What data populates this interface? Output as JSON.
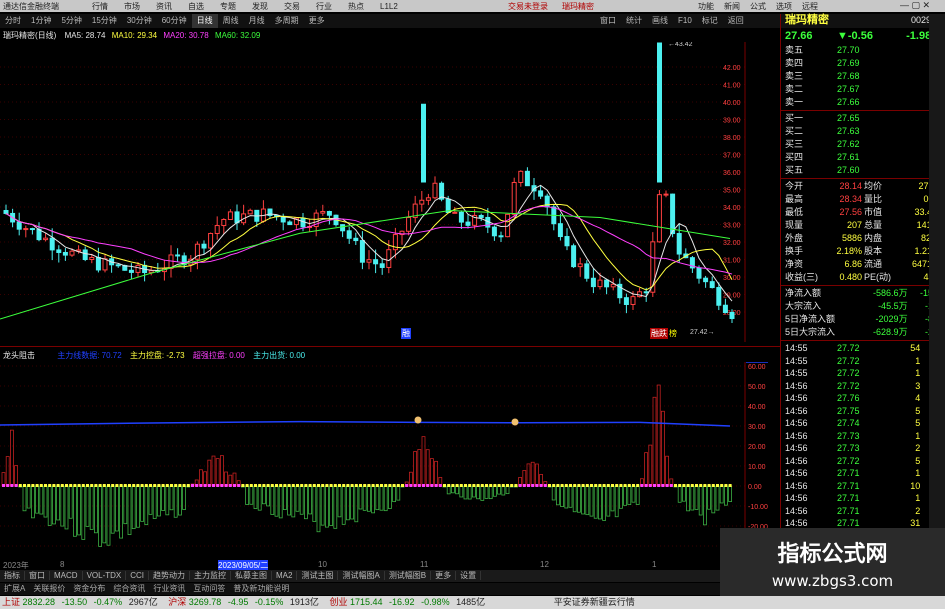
{
  "titlebar": {
    "app_title": "通达信金融终端",
    "menus": [
      "行情",
      "市场",
      "资讯",
      "自选",
      "专题",
      "发现",
      "交易",
      "行业",
      "热点",
      "L1L2"
    ],
    "center_links": [
      "交易未登录",
      "瑞玛精密"
    ],
    "right_links": [
      "功能",
      "新闻",
      "公式",
      "选项",
      "远程"
    ]
  },
  "periodbar": {
    "periods": [
      "分时",
      "1分钟",
      "5分钟",
      "15分钟",
      "30分钟",
      "60分钟",
      "日线",
      "周线",
      "月线",
      "多周期",
      "更多"
    ],
    "active": "日线",
    "right_tools": [
      "窗口",
      "统计",
      "画线",
      "F10",
      "标记",
      "返回"
    ]
  },
  "chart": {
    "stock_label": "瑞玛精密(日线)",
    "ma5": "MA5: 28.74",
    "ma10": "MA10: 29.34",
    "ma20": "MA20: 30.78",
    "ma60": "MA60: 32.09",
    "high_label": "43.42",
    "low_label": "27.42",
    "y_ticks": [
      "42.00",
      "41.00",
      "40.00",
      "39.00",
      "38.00",
      "37.00",
      "36.00",
      "35.00",
      "34.00",
      "33.00",
      "32.00",
      "31.00",
      "30.00",
      "29.00",
      "28.00"
    ],
    "marker_left": "融",
    "marker_right": "融跌",
    "marker_right2": "榜"
  },
  "indicator": {
    "name": "龙头阻击",
    "items": [
      "主力线数据: 70.72",
      "主力控盘: -2.73",
      "超强拉盘: 0.00",
      "主力出货: 0.00"
    ],
    "y_ticks": [
      "63.63",
      "60.00",
      "50.00",
      "40.00",
      "30.00",
      "20.00",
      "10.00",
      "0.00",
      "-10.00",
      "-20.00",
      "-30.00"
    ],
    "date_labels": [
      "2023年",
      "8",
      "2023/09/05/二",
      "10",
      "11",
      "12",
      "1"
    ]
  },
  "quote": {
    "name": "瑞玛精密",
    "code": "002976",
    "price": "27.66",
    "change": "▼-0.56",
    "pct": "-1.98%",
    "sells": [
      {
        "label": "卖五",
        "price": "27.70",
        "vol": "33"
      },
      {
        "label": "卖四",
        "price": "27.69",
        "vol": "2"
      },
      {
        "label": "卖三",
        "price": "27.68",
        "vol": "1"
      },
      {
        "label": "卖二",
        "price": "27.67",
        "vol": "4"
      },
      {
        "label": "卖一",
        "price": "27.66",
        "vol": "17"
      }
    ],
    "buys": [
      {
        "label": "买一",
        "price": "27.65",
        "vol": "6"
      },
      {
        "label": "买二",
        "price": "27.63",
        "vol": "2"
      },
      {
        "label": "买三",
        "price": "27.62",
        "vol": "18"
      },
      {
        "label": "买四",
        "price": "27.61",
        "vol": "2"
      },
      {
        "label": "买五",
        "price": "27.60",
        "vol": "7"
      }
    ],
    "stats": [
      {
        "k1": "今开",
        "v1": "28.14",
        "k2": "均价",
        "v2": "27.95"
      },
      {
        "k1": "最高",
        "v1": "28.34",
        "k2": "量比",
        "v2": "0.74"
      },
      {
        "k1": "最低",
        "v1": "27.56",
        "k2": "市值",
        "v2": "33.4亿"
      },
      {
        "k1": "现量",
        "v1": "207",
        "k2": "总量",
        "v2": "14114"
      },
      {
        "k1": "外盘",
        "v1": "5886",
        "k2": "内盘",
        "v2": "8228"
      },
      {
        "k1": "换手",
        "v1": "2.18%",
        "k2": "股本",
        "v2": "1.21亿"
      },
      {
        "k1": "净资",
        "v1": "6.86",
        "k2": "流通",
        "v2": "6471万"
      },
      {
        "k1": "收益(三)",
        "v1": "0.480",
        "k2": "PE(动)",
        "v2": "43.0"
      }
    ],
    "flows": [
      {
        "label": "净流入额",
        "value": "-586.6万",
        "pct": "-15%"
      },
      {
        "label": "大宗流入",
        "value": "-45.5万",
        "pct": "-1%"
      },
      {
        "label": "5日净流入额",
        "value": "-2029万",
        "pct": "-8%"
      },
      {
        "label": "5日大宗流入",
        "value": "-628.9万",
        "pct": "-2%"
      }
    ],
    "ticks": [
      {
        "t": "14:55",
        "p": "27.72",
        "v": "54",
        "d": "B"
      },
      {
        "t": "14:55",
        "p": "27.72",
        "v": "1",
        "d": "B"
      },
      {
        "t": "14:55",
        "p": "27.72",
        "v": "1",
        "d": "B"
      },
      {
        "t": "14:56",
        "p": "27.72",
        "v": "3",
        "d": "S"
      },
      {
        "t": "14:56",
        "p": "27.76",
        "v": "4",
        "d": "S"
      },
      {
        "t": "14:56",
        "p": "27.75",
        "v": "5",
        "d": "B"
      },
      {
        "t": "14:56",
        "p": "27.74",
        "v": "5",
        "d": "B"
      },
      {
        "t": "14:56",
        "p": "27.73",
        "v": "1",
        "d": "B"
      },
      {
        "t": "14:56",
        "p": "27.73",
        "v": "2",
        "d": "B"
      },
      {
        "t": "14:56",
        "p": "27.72",
        "v": "5",
        "d": "S"
      },
      {
        "t": "14:56",
        "p": "27.71",
        "v": "1",
        "d": "S"
      },
      {
        "t": "14:56",
        "p": "27.71",
        "v": "10",
        "d": "S"
      },
      {
        "t": "14:56",
        "p": "27.71",
        "v": "1",
        "d": "B"
      },
      {
        "t": "14:56",
        "p": "27.71",
        "v": "2",
        "d": "S"
      },
      {
        "t": "14:56",
        "p": "27.71",
        "v": "31",
        "d": "S"
      },
      {
        "t": "14:56",
        "p": "27.71",
        "v": "5",
        "d": "B"
      },
      {
        "t": "14:56",
        "p": "27.71",
        "v": "1",
        "d": "B"
      }
    ]
  },
  "bottom_tabs": [
    "指标",
    "窗口",
    "MACD",
    "VOL-TDX",
    "CCI",
    "趋势动力",
    "主力监控",
    "私募主图",
    "MA2",
    "测试主图",
    "测试幅图A",
    "测试幅图B",
    "更多",
    "设置"
  ],
  "bottom_tabs2": [
    "扩展A",
    "关联报价",
    "资金分布",
    "综合资讯",
    "行业资讯",
    "互动问答",
    "普及新功能说明"
  ],
  "statusbar": {
    "sh_label": "上证",
    "sh_val": "2832.28",
    "sh_chg": "-13.50",
    "sh_pct": "-0.47%",
    "sh_amt": "2967亿",
    "sz_label": "沪深",
    "sz_val": "3269.78",
    "sz_chg": "-4.95",
    "sz_pct": "-0.15%",
    "sz_amt": "1913亿",
    "cy_label": "创业",
    "cy_val": "1715.44",
    "cy_chg": "-16.92",
    "cy_pct": "-0.98%",
    "cy_amt": "1485亿",
    "broker": "平安证券新疆云行情"
  },
  "watermark": {
    "line1": "指标公式网",
    "line2": "www.zbgs3.com"
  },
  "colors": {
    "up": "#ff4040",
    "down": "#4cf0f0",
    "ma5": "#e6e6e6",
    "ma10": "#ffff40",
    "ma20": "#ff40ff",
    "ma60": "#3cff3c",
    "main_line": "#2040ff"
  }
}
